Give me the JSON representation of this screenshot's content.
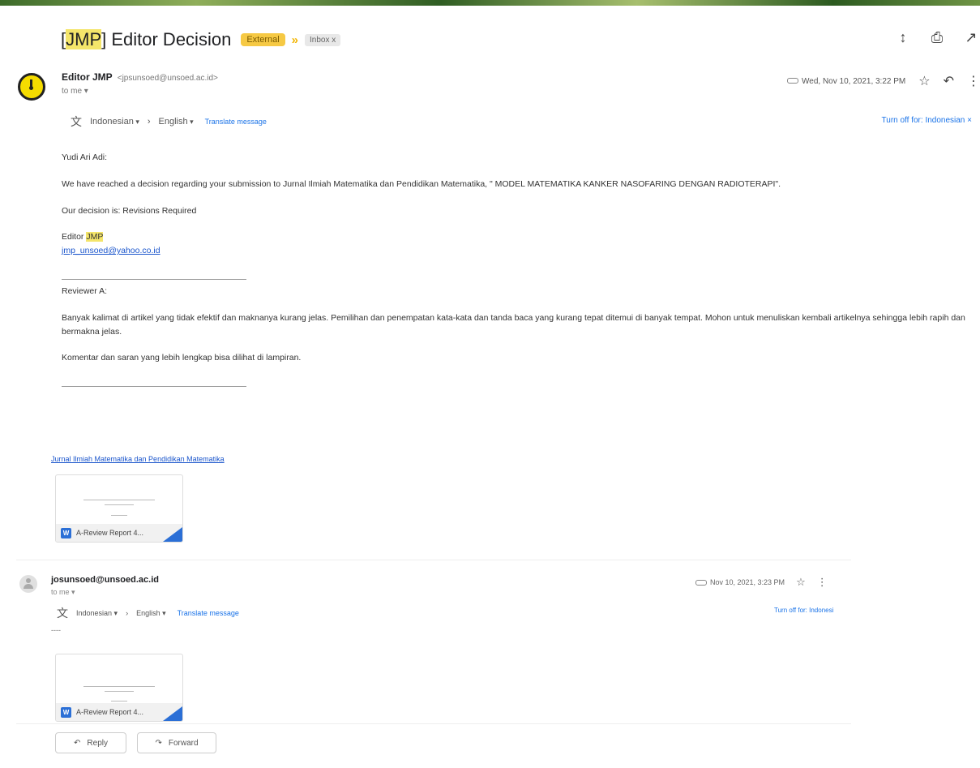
{
  "subject": {
    "prefix": "[",
    "highlight": "JMP",
    "rest": "] Editor Decision",
    "label_external": "External",
    "label_inbox": "Inbox x"
  },
  "top_icons": [
    "expand-icon",
    "print-icon",
    "open-new-window-icon"
  ],
  "message1": {
    "sender_name": "Editor JMP",
    "sender_email": "<jpsunsoed@unsoed.ac.id>",
    "to": "to me",
    "date": "Wed, Nov 10, 2021, 3:22 PM",
    "translate": {
      "from_lang": "Indonesian",
      "to_lang": "English",
      "link": "Translate message",
      "turn_off": "Turn off for: Indonesian"
    },
    "greeting": "Yudi Ari Adi:",
    "decision_intro": "We have reached a decision regarding your submission to Jurnal Ilmiah Matematika dan Pendidikan Matematika, \" MODEL MATEMATIKA KANKER NASOFARING DENGAN RADIOTERAPI\".",
    "decision": "Our decision is: Revisions Required",
    "signature_prefix": "Editor",
    "signature_highlight": "JMP",
    "signature_email": "jmp_unsoed@yahoo.co.id",
    "reviewer": "Reviewer A:",
    "review_text": "Banyak kalimat di artikel yang tidak efektif dan maknanya kurang jelas. Pemilihan dan penempatan kata-kata dan tanda baca yang kurang tepat ditemui di banyak tempat. Mohon untuk menuliskan kembali artikelnya sehingga lebih rapih dan bermakna jelas.",
    "comment": "Komentar dan saran yang lebih lengkap bisa dilihat di lampiran.",
    "footer_link": "Jurnal Ilmiah Matematika dan Pendidikan Matematika",
    "attachment": "A-Review Report 4..."
  },
  "message2": {
    "sender_email": "josunsoed@unsoed.ac.id",
    "to": "to me",
    "date": "Nov 10, 2021, 3:23 PM",
    "translate": {
      "from_lang": "Indonesian",
      "to_lang": "English",
      "link": "Translate message",
      "turn_off": "Turn off for: Indonesi"
    },
    "body": "----",
    "attachment": "A-Review Report 4..."
  },
  "actions": {
    "reply": "Reply",
    "forward": "Forward"
  },
  "colors": {
    "highlight": "#f4e56a",
    "link": "#1a73e8",
    "external_label": "#f6c944",
    "word_blue": "#2b6fd6"
  }
}
